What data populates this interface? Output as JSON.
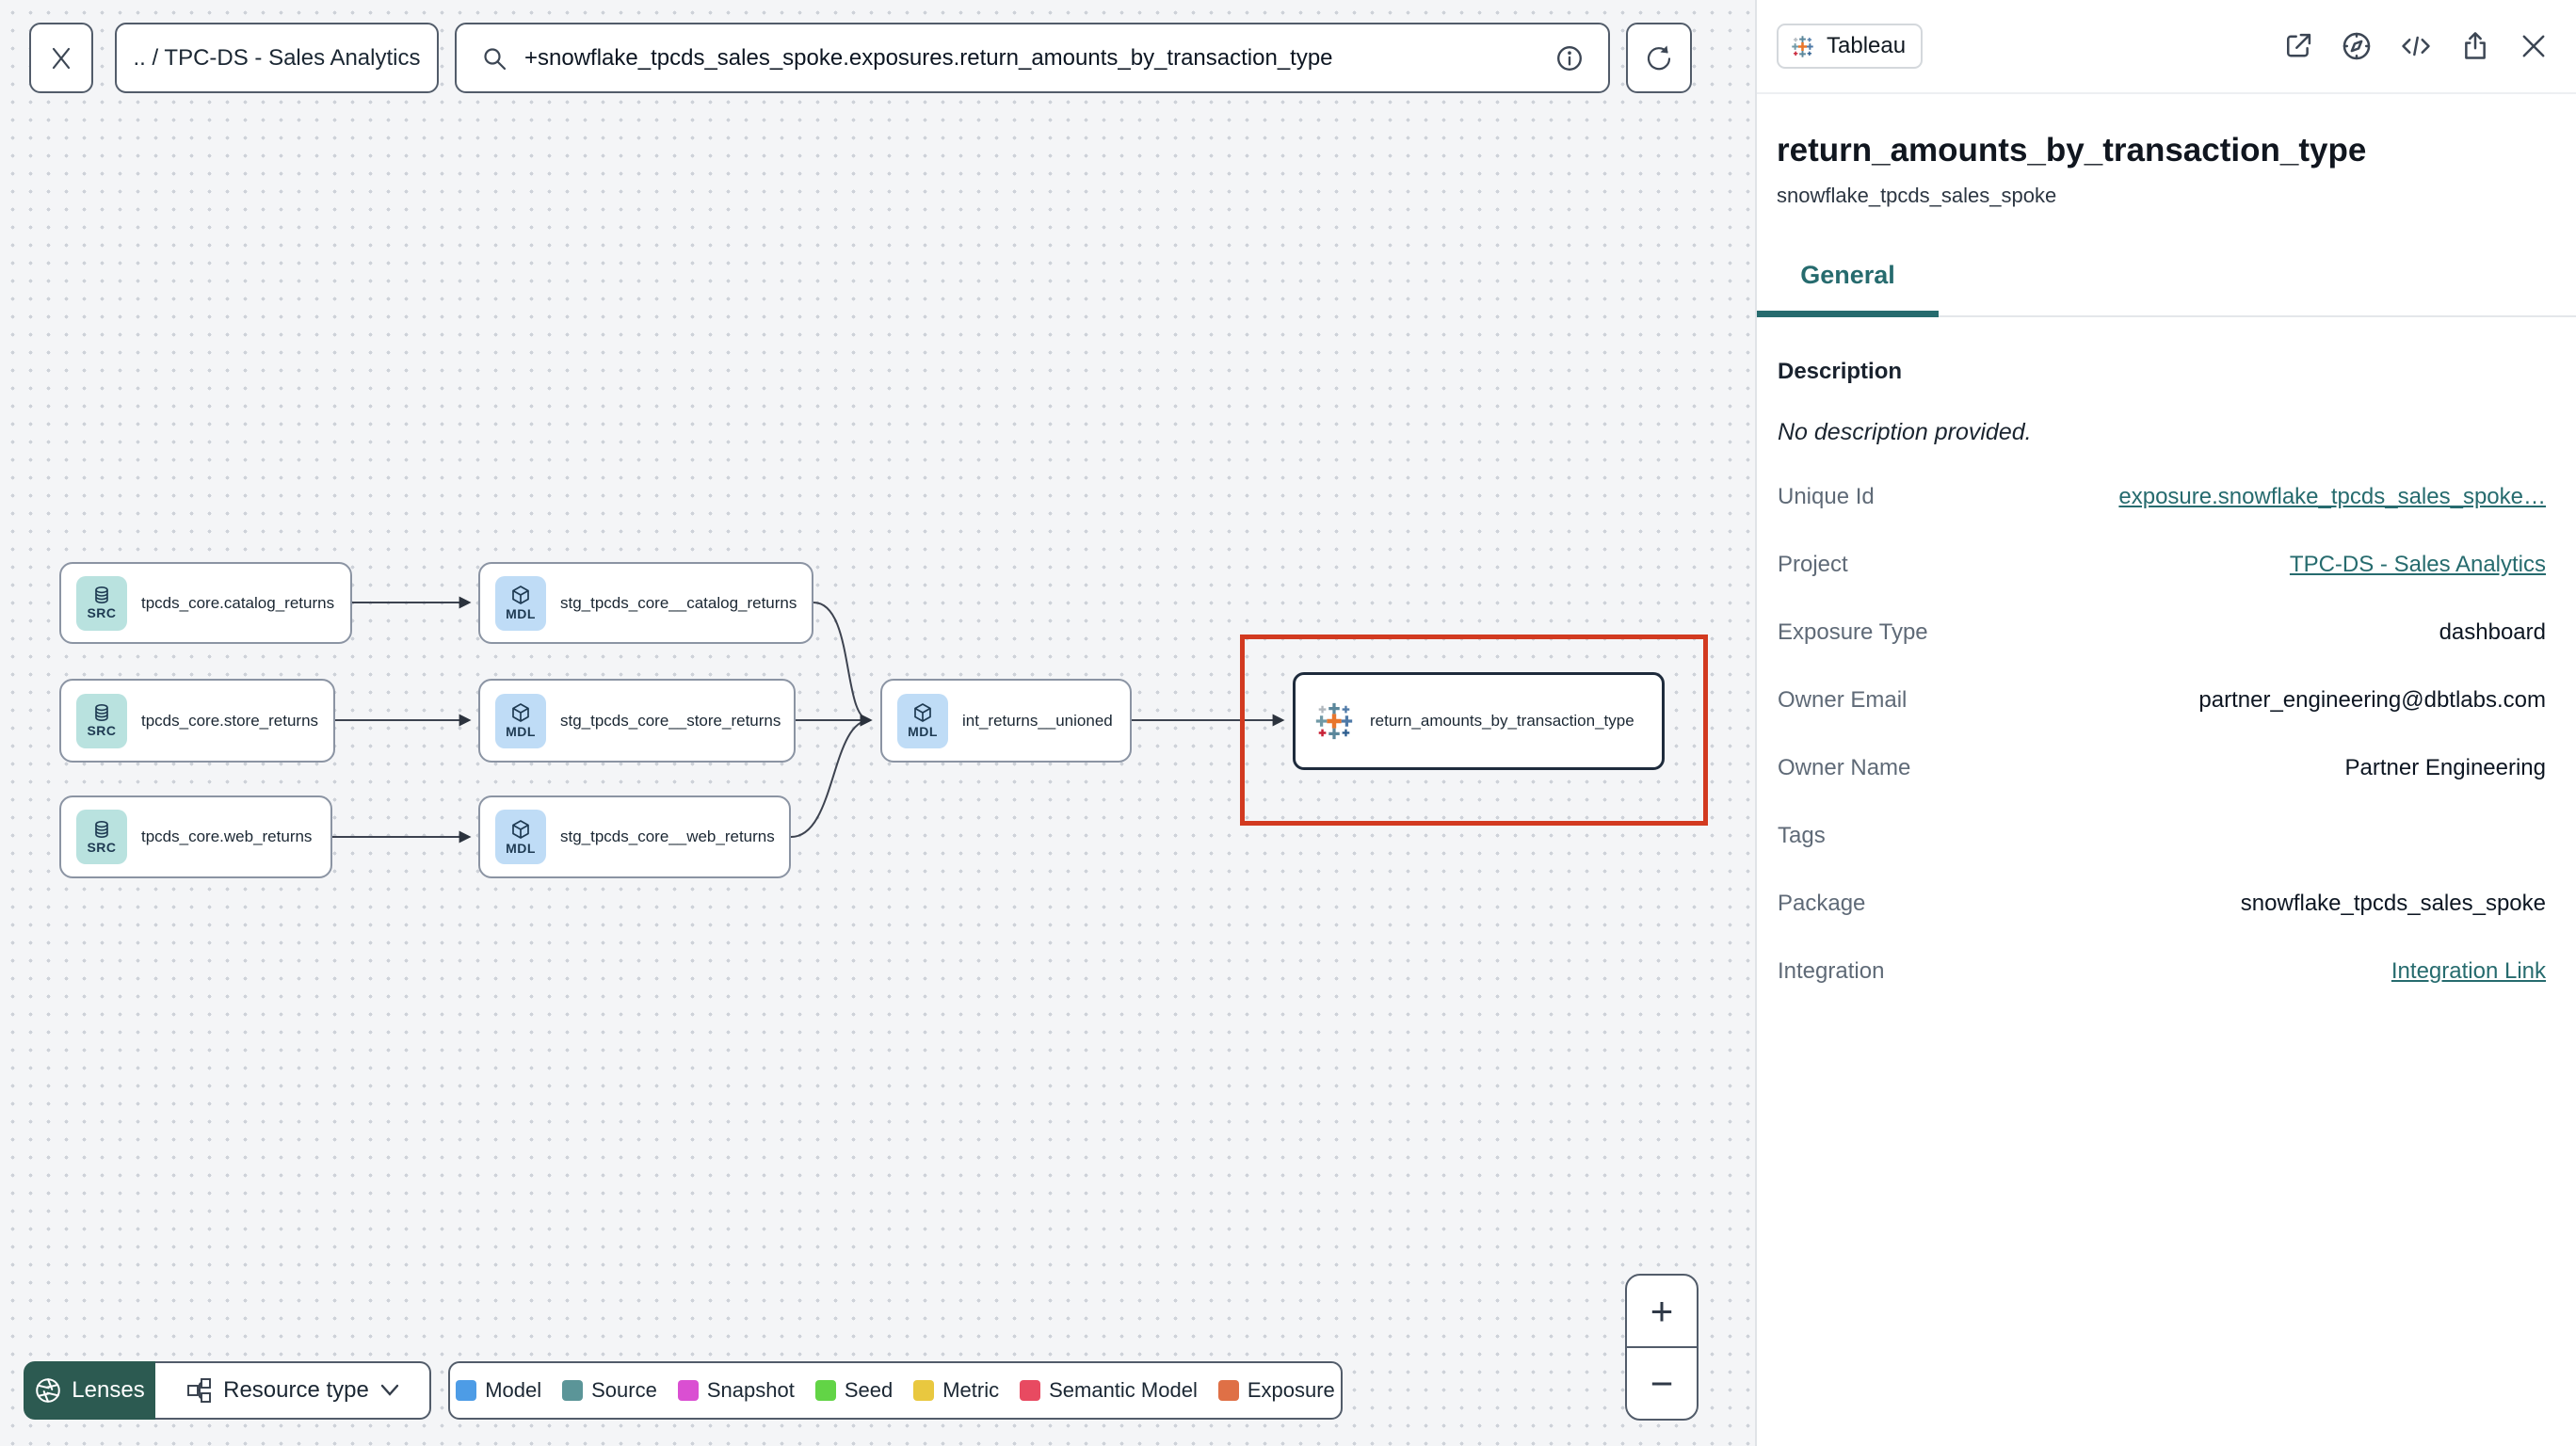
{
  "colors": {
    "accent": "#266b6e",
    "selection_red": "#d23a20",
    "lenses_green": "#2c5a51"
  },
  "topbar": {
    "breadcrumb": ".. / TPC-DS - Sales Analytics",
    "search_value": "+snowflake_tpcds_sales_spoke.exposures.return_amounts_by_transaction_type"
  },
  "graph": {
    "nodes": [
      {
        "badge": "SRC",
        "label": "tpcds_core.catalog_returns"
      },
      {
        "badge": "SRC",
        "label": "tpcds_core.store_returns"
      },
      {
        "badge": "SRC",
        "label": "tpcds_core.web_returns"
      },
      {
        "badge": "MDL",
        "label": "stg_tpcds_core__catalog_returns"
      },
      {
        "badge": "MDL",
        "label": "stg_tpcds_core__store_returns"
      },
      {
        "badge": "MDL",
        "label": "stg_tpcds_core__web_returns"
      },
      {
        "badge": "MDL",
        "label": "int_returns__unioned"
      },
      {
        "badge": "",
        "label": "return_amounts_by_transaction_type"
      }
    ]
  },
  "controls": {
    "lenses_label": "Lenses",
    "resource_type_label": "Resource type"
  },
  "legend": {
    "items": [
      {
        "label": "Model",
        "color": "#4d9ce6"
      },
      {
        "label": "Source",
        "color": "#5b9598"
      },
      {
        "label": "Snapshot",
        "color": "#da4fd2"
      },
      {
        "label": "Seed",
        "color": "#62d446"
      },
      {
        "label": "Metric",
        "color": "#e9c83f"
      },
      {
        "label": "Semantic Model",
        "color": "#e84a61"
      },
      {
        "label": "Exposure",
        "color": "#df7046"
      }
    ]
  },
  "zoom_controls": {
    "zoom_in": "+",
    "zoom_out": "−"
  },
  "panel": {
    "source_badge": "Tableau",
    "title": "return_amounts_by_transaction_type",
    "subtitle": "snowflake_tpcds_sales_spoke",
    "tabs": [
      {
        "label": "General"
      }
    ],
    "description_label": "Description",
    "description_value": "No description provided.",
    "fields": [
      {
        "label": "Unique Id",
        "value": "exposure.snowflake_tpcds_sales_spoke…"
      },
      {
        "label": "Project",
        "value": "TPC-DS - Sales Analytics"
      },
      {
        "label": "Exposure Type",
        "value": "dashboard"
      },
      {
        "label": "Owner Email",
        "value": "partner_engineering@dbtlabs.com"
      },
      {
        "label": "Owner Name",
        "value": "Partner Engineering"
      },
      {
        "label": "Tags",
        "value": ""
      },
      {
        "label": "Package",
        "value": "snowflake_tpcds_sales_spoke"
      },
      {
        "label": "Integration",
        "value": "Integration Link"
      }
    ]
  }
}
